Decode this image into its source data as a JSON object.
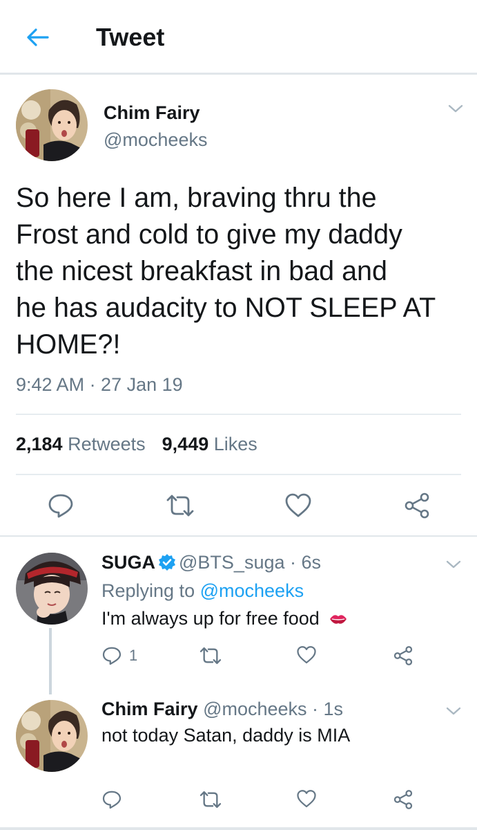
{
  "header": {
    "title": "Tweet",
    "back_icon": "arrow-left-icon"
  },
  "main_tweet": {
    "name": "Chim Fairy",
    "handle": "@mocheeks",
    "text_lines": [
      "So here I am, braving thru the",
      "Frost and cold to give my daddy",
      "the nicest breakfast in bad and",
      "he has audacity to NOT SLEEP AT",
      "HOME?!"
    ],
    "timestamp": "9:42 AM · 27 Jan 19",
    "retweets_count": "2,184",
    "retweets_label": "Retweets",
    "likes_count": "9,449",
    "likes_label": "Likes"
  },
  "replies": [
    {
      "name": "SUGA",
      "verified": true,
      "handle": "@BTS_suga",
      "time": "· 6s",
      "replying_label": "Replying to",
      "replying_to": "@mocheeks",
      "text": "I'm always up for free food",
      "emoji": "💋",
      "reply_count": "1"
    },
    {
      "name": "Chim Fairy",
      "verified": false,
      "handle": "@mocheeks",
      "time": "· 1s",
      "text": "not today Satan, daddy is MIA"
    }
  ],
  "colors": {
    "accent": "#1da1f2",
    "text": "#14171a",
    "muted": "#657786",
    "border": "#e1e6ea",
    "kiss": "#e0245e"
  }
}
